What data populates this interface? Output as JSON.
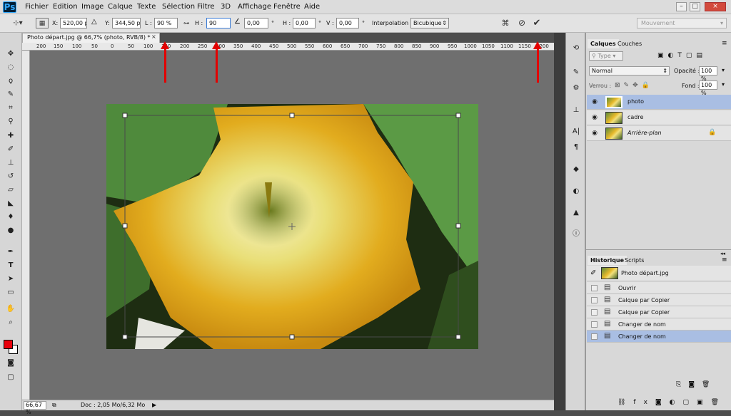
{
  "app": {
    "logo": "Ps"
  },
  "menu": [
    "Fichier",
    "Edition",
    "Image",
    "Calque",
    "Texte",
    "Sélection",
    "Filtre",
    "3D",
    "Affichage",
    "Fenêtre",
    "Aide"
  ],
  "window_controls": {
    "minimize": "–",
    "restore": "□",
    "close": "×"
  },
  "options": {
    "x_label": "X:",
    "x_value": "520,00 px",
    "y_label": "Y:",
    "y_value": "344,50 px",
    "w_label": "L :",
    "w_value": "90 %",
    "link_icon": "link-icon",
    "h_label": "H :",
    "h_value": "90",
    "angle_value": "0,00",
    "hskew_label": "H :",
    "hskew_value": "0,00",
    "vskew_label": "V :",
    "vskew_value": "0,00",
    "degree": "°",
    "interp_label": "Interpolation :",
    "interp_value": "Bicubique",
    "mode_value": "Mouvement"
  },
  "document": {
    "tab_title": "Photo départ.jpg @ 66,7% (photo, RVB/8) *",
    "close": "×"
  },
  "ruler_ticks": [
    "200",
    "150",
    "100",
    "50",
    "0",
    "50",
    "100",
    "150",
    "200",
    "250",
    "300",
    "350",
    "400",
    "450",
    "500",
    "550",
    "600",
    "650",
    "700",
    "750",
    "800",
    "850",
    "900",
    "950",
    "1000",
    "1050",
    "1100",
    "1150",
    "1200"
  ],
  "status": {
    "zoom": "66,67 %",
    "doc": "Doc : 2,05 Mo/6,32 Mo"
  },
  "layers_panel": {
    "tabs": [
      "Calques",
      "Couches"
    ],
    "filter_placeholder": "Type",
    "blend_mode": "Normal",
    "opacity_label": "Opacité :",
    "opacity_value": "100 %",
    "lock_label": "Verrou :",
    "fill_label": "Fond :",
    "fill_value": "100 %",
    "layers": [
      {
        "name": "photo",
        "selected": true
      },
      {
        "name": "cadre",
        "selected": false
      },
      {
        "name": "Arrière-plan",
        "selected": false,
        "locked": true
      }
    ]
  },
  "history_panel": {
    "tabs": [
      "Historique",
      "Scripts"
    ],
    "snapshot": "Photo départ.jpg",
    "items": [
      {
        "label": "Ouvrir",
        "selected": false
      },
      {
        "label": "Calque par Copier",
        "selected": false
      },
      {
        "label": "Calque par Copier",
        "selected": false
      },
      {
        "label": "Changer de nom",
        "selected": false
      },
      {
        "label": "Changer de nom",
        "selected": true
      }
    ]
  },
  "colors": {
    "foreground": "#e8000b",
    "background": "#ffffff",
    "annotation_arrow": "#e20000",
    "selection": "#a9bee3"
  }
}
